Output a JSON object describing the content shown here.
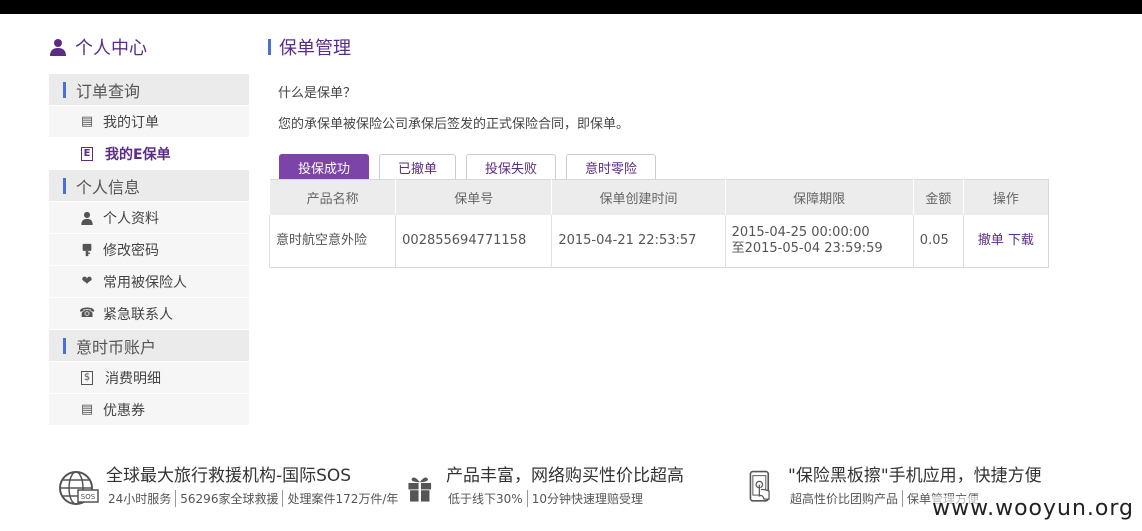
{
  "sidebar": {
    "title": "个人中心",
    "sections": [
      {
        "label": "订单查询",
        "items": [
          {
            "label": "我的订单",
            "icon": "document-icon",
            "glyph": "▤",
            "active": false
          },
          {
            "label": "我的E保单",
            "icon": "e-policy-icon",
            "glyph": "E",
            "active": true
          }
        ]
      },
      {
        "label": "个人信息",
        "items": [
          {
            "label": "个人资料",
            "icon": "user-icon",
            "glyph": "●",
            "active": false
          },
          {
            "label": "修改密码",
            "icon": "key-icon",
            "glyph": "⚿",
            "active": false
          },
          {
            "label": "常用被保险人",
            "icon": "heart-icon",
            "glyph": "❤",
            "active": false
          },
          {
            "label": "紧急联系人",
            "icon": "phone-icon",
            "glyph": "☎",
            "active": false
          }
        ]
      },
      {
        "label": "意时币账户",
        "items": [
          {
            "label": "消费明细",
            "icon": "dollar-icon",
            "glyph": "$",
            "active": false
          },
          {
            "label": "优惠券",
            "icon": "coupon-icon",
            "glyph": "▤",
            "active": false
          }
        ]
      }
    ]
  },
  "main": {
    "title": "保单管理",
    "faq_question": "什么是保单？",
    "faq_answer": "您的承保单被保险公司承保后签发的正式保险合同，即保单。",
    "tabs": [
      "投保成功",
      "已撤单",
      "投保失败",
      "意时零险"
    ],
    "active_tab": 0,
    "table": {
      "headers": [
        "产品名称",
        "保单号",
        "保单创建时间",
        "保障期限",
        "金额",
        "操作"
      ],
      "rows": [
        {
          "product": "意时航空意外险",
          "policy_no": "002855694771158",
          "created": "2015-04-21 22:53:57",
          "period_start": "2015-04-25 00:00:00",
          "period_end": "至2015-05-04 23:59:59",
          "amount": "0.05",
          "action_cancel": "撤单",
          "action_download": "下载"
        }
      ]
    }
  },
  "footer": {
    "blocks": [
      {
        "title": "全球最大旅行救援机构-国际SOS",
        "icon": "globe-sos-icon",
        "subs": [
          "24小时服务",
          "56296家全球救援",
          "处理案件172万件/年"
        ]
      },
      {
        "title": "产品丰富，网络购买性价比超高",
        "icon": "gift-icon",
        "subs": [
          "低于线下30%",
          "10分钟快速理赔受理"
        ]
      },
      {
        "title": "\"保险黑板擦\"手机应用，快捷方便",
        "icon": "mobile-touch-icon",
        "subs": [
          "超高性价比团购产品",
          "保单管理方便"
        ]
      }
    ],
    "watermark": "www.wooyun.org"
  },
  "colors": {
    "accent": "#5b2c86",
    "tab_active": "#7c44a8",
    "bar": "#4a6fd6"
  }
}
